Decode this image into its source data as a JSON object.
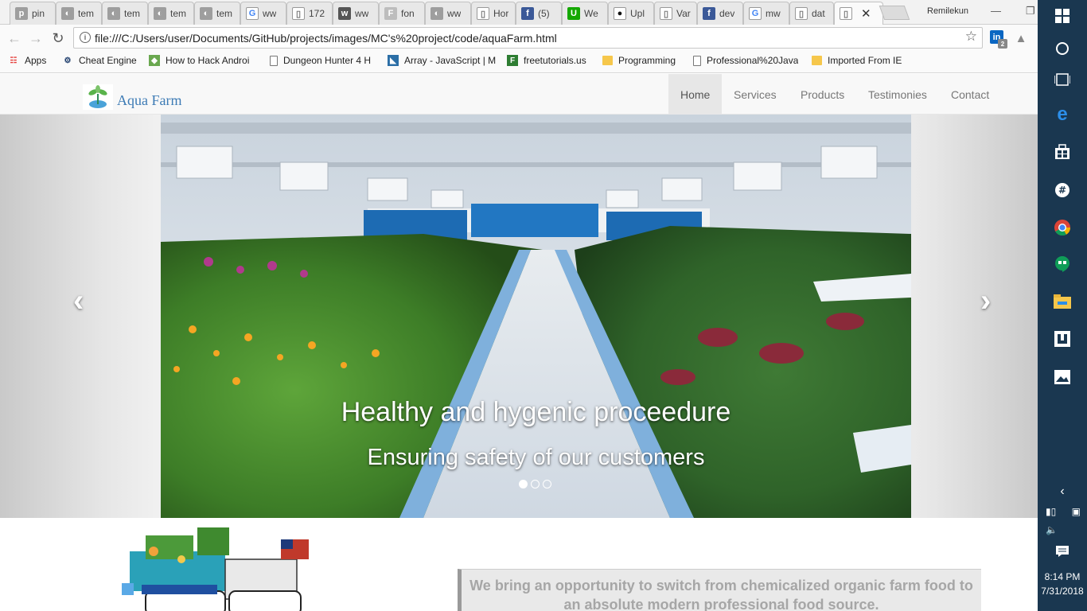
{
  "browser": {
    "tabs": [
      {
        "label": "pin",
        "icon": "pinterest-icon"
      },
      {
        "label": "tem",
        "icon": "tab-page-icon"
      },
      {
        "label": "tem",
        "icon": "tab-page-icon"
      },
      {
        "label": "tem",
        "icon": "tab-page-icon"
      },
      {
        "label": "tem",
        "icon": "tab-page-icon"
      },
      {
        "label": "ww",
        "icon": "google-icon"
      },
      {
        "label": "172",
        "icon": "document-icon"
      },
      {
        "label": "ww",
        "icon": "w3schools-icon"
      },
      {
        "label": "fon",
        "icon": "font-icon"
      },
      {
        "label": "ww",
        "icon": "tab-page-icon"
      },
      {
        "label": "Hor",
        "icon": "document-icon"
      },
      {
        "label": "(5)",
        "icon": "facebook-icon"
      },
      {
        "label": "We",
        "icon": "upwork-icon"
      },
      {
        "label": "Upl",
        "icon": "github-icon"
      },
      {
        "label": "Var",
        "icon": "document-icon"
      },
      {
        "label": "dev",
        "icon": "facebook-icon"
      },
      {
        "label": "mw",
        "icon": "google-icon"
      },
      {
        "label": "dat",
        "icon": "document-icon"
      },
      {
        "label": "",
        "icon": "document-icon",
        "active": true
      }
    ],
    "profile_name": "Remilekun",
    "address_url": "file:///C:/Users/user/Documents/GitHub/projects/images/MC's%20project/code/aquaFarm.html",
    "extension_badge": "2",
    "bookmarks": [
      {
        "label": "Apps",
        "icon": "apps-grid-icon"
      },
      {
        "label": "Cheat Engine",
        "icon": "cheat-engine-icon"
      },
      {
        "label": "How to Hack Androi",
        "icon": "android-icon"
      },
      {
        "label": "Dungeon Hunter 4 H",
        "icon": "document-icon"
      },
      {
        "label": "Array - JavaScript | M",
        "icon": "mdn-icon"
      },
      {
        "label": "freetutorials.us",
        "icon": "ftu-icon"
      },
      {
        "label": "Programming",
        "icon": "folder-icon"
      },
      {
        "label": "Professional%20Java",
        "icon": "document-icon"
      },
      {
        "label": "Imported From IE",
        "icon": "folder-icon"
      }
    ]
  },
  "site": {
    "brand_name": "Aqua Farm",
    "nav": [
      {
        "label": "Home",
        "active": true
      },
      {
        "label": "Services",
        "active": false
      },
      {
        "label": "Products",
        "active": false
      },
      {
        "label": "Testimonies",
        "active": false
      },
      {
        "label": "Contact",
        "active": false
      }
    ],
    "carousel": {
      "caption_title": "Healthy and hygenic proceedure",
      "caption_subtitle": "Ensuring safety of our customers",
      "slide_count": 3,
      "active_slide": 1
    },
    "quote_text": "We bring an opportunity to switch from chemicalized organic farm food to an absolute modern professional food source."
  },
  "taskbar": {
    "time": "8:14 PM",
    "date": "7/31/2018"
  },
  "colors": {
    "brand_blue": "#3d7bb5",
    "taskbar_bg": "#1a3750",
    "navbar_bg": "#f8f8f8"
  }
}
